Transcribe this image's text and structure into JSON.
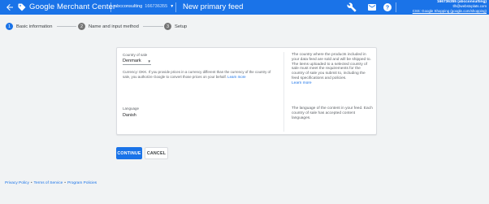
{
  "topbar": {
    "app_title": "Google Merchant Center",
    "account_name": "abcconsulting",
    "account_id": "166736355",
    "page_title": "New primary feed",
    "account_info": {
      "name": "166736355 (abcconsulting)",
      "email": "tlh@webstxplats.com",
      "link": "CSS: Google Shopping (google.com/shopping)"
    },
    "icons": [
      "back-arrow-icon",
      "merchant-center-logo",
      "wrench-icon",
      "mail-icon",
      "help-icon",
      "account-avatar"
    ]
  },
  "stepper": {
    "steps": [
      {
        "number": "1",
        "label": "Basic information",
        "active": true
      },
      {
        "number": "2",
        "label": "Name and input method",
        "active": false
      },
      {
        "number": "3",
        "label": "Setup",
        "active": false
      }
    ]
  },
  "form": {
    "country": {
      "label": "Country of sale",
      "value": "Denmark",
      "help": "Currency: DKK. If you provide prices in a currency different than the currency of the country of sale, you authorize Google to convert those prices on your behalf.",
      "help_link": "Learn more",
      "side_help": "The country where the products included in your data feed are sold and will be shipped to. The items uploaded to a selected country of sale must meet the requirements for the country of sale you submit to, including the feed specifications and policies.",
      "side_link": "Learn more"
    },
    "language": {
      "label": "Language",
      "value": "Danish",
      "side_help": "The language of the content in your feed. Each country of sale has accepted content languages."
    }
  },
  "actions": {
    "continue": "CONTINUE",
    "cancel": "CANCEL"
  },
  "footer": {
    "privacy": "Privacy Policy",
    "sep1": "•",
    "terms": "Terms of Service",
    "sep2": "•",
    "program": "Program Policies"
  },
  "colors": {
    "brand": "#1a73e8",
    "background": "#f1f3f4",
    "step_idle": "#757575"
  }
}
